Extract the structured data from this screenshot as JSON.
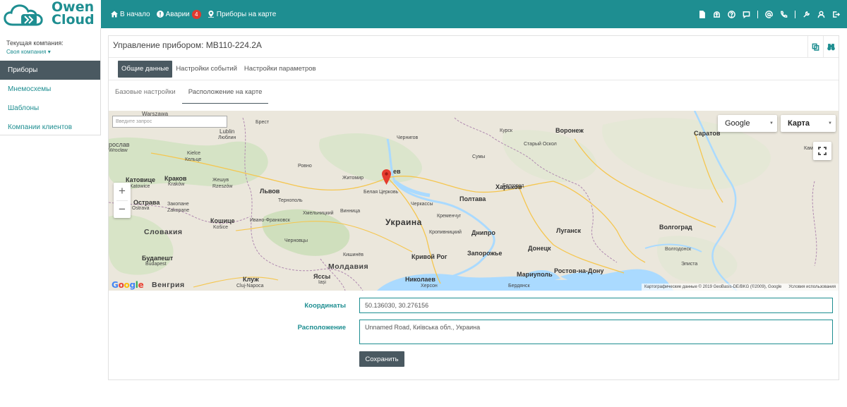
{
  "brand": {
    "logo_text_line1": "Owen",
    "logo_text_line2": "Cloud",
    "primary_color": "#1e8e91",
    "dark_color": "#4a5961",
    "alert_color": "#e03a2f"
  },
  "nav": {
    "home_label": "В начало",
    "alarms_label": "Аварии",
    "alarms_count": "4",
    "map_label": "Приборы на карте"
  },
  "top_icons": [
    "document-icon",
    "upload-icon",
    "help-icon",
    "chat-icon",
    "at-icon",
    "phone-icon",
    "wrench-icon",
    "user-icon",
    "logout-icon"
  ],
  "sidebar": {
    "company_label": "Текущая компания:",
    "company_value": "Своя компания",
    "items": [
      {
        "label": "Приборы",
        "active": true
      },
      {
        "label": "Мнемосхемы",
        "active": false
      },
      {
        "label": "Шаблоны",
        "active": false
      },
      {
        "label": "Компании клиентов",
        "active": false
      }
    ]
  },
  "panel": {
    "title": "Управление прибором: МВ110-224.2А",
    "subtabs": [
      "Общие данные",
      "Настройки событий",
      "Настройки параметров"
    ],
    "tabs": [
      "Базовые настройки",
      "Расположение на карте"
    ]
  },
  "map": {
    "search_placeholder": "Введите запрос",
    "provider": "Google",
    "type": "Карта",
    "zoom_in": "+",
    "zoom_out": "−",
    "attribution": "Картографические данные © 2019 GeoBasis-DE/BKG (©2009), Google",
    "terms": "Условия использования",
    "labels": {
      "warszawa": "Warszawa",
      "lublin": "Lublin",
      "lublin_ru": "Люблин",
      "brest": "Брест",
      "chernigov": "Чернигов",
      "kursk": "Курск",
      "voronezh": "Воронеж",
      "saratov": "Саратов",
      "roslav": "рослав",
      "wroclaw": "Wrocław",
      "kielce": "Kielce",
      "kielce_ru": "Кельце",
      "rovno": "Ровно",
      "sumy": "Сумы",
      "stary_oskol": "Старый Оскол",
      "katowice": "Катовице",
      "katowice_pl": "Katowice",
      "krakow": "Краков",
      "krakow_pl": "Kraków",
      "zheshuv": "Жешув",
      "rzeszow": "Rzeszów",
      "lvov": "Львов",
      "zhitomir": "Житомир",
      "kiev": "ев",
      "belgorod": "Белгород",
      "kharkov": "Харьков",
      "ternopol": "Тернополь",
      "belaya_tserkov": "Белая Церковь",
      "ostrava": "Острава",
      "ostrava_cz": "Ostrava",
      "zakopane": "Закопане",
      "zakopane_pl": "Zakopane",
      "vinnitsa": "Винница",
      "cherkassy": "Черкассы",
      "poltava": "Полтава",
      "khmelnitsky": "Хмельницкий",
      "kremenchug": "Кременчуг",
      "kamyshin": "Камышин",
      "koshice": "Кошице",
      "koshice_sk": "Košice",
      "ivano_frankovsk": "Ивано-Франковск",
      "ukraine": "Украина",
      "kropyvnytskyi": "Кропивницкий",
      "dnipro": "Днипро",
      "lugansk": "Луганск",
      "volgograd": "Волгоград",
      "slovakia": "Словакия",
      "chernovtsy": "Черновцы",
      "donetsk": "Донецк",
      "budapest": "Будапешт",
      "budapest_hu": "Budapest",
      "krivoy_rog": "Кривой Рог",
      "zaporozhye": "Запорожье",
      "volgodonsk": "Волгодонск",
      "kishinev": "Кишинёв",
      "moldova": "Молдавия",
      "mariupol": "Мариуполь",
      "rostov": "Ростов-на-Дону",
      "elista": "Элиста",
      "yassy": "Яссы",
      "iasi": "Iași",
      "nikolaev": "Николаев",
      "kherson": "Херсон",
      "hungary": "Венгрия",
      "cluj": "Клуж",
      "cluj_ro": "Cluj-Napoca",
      "berdyansk": "Бердянск"
    }
  },
  "form": {
    "coords_label": "Координаты",
    "coords_value": "50.136030, 30.276156",
    "location_label": "Расположение",
    "location_value": "Unnamed Road, Київська обл., Украина",
    "save_label": "Сохранить"
  }
}
